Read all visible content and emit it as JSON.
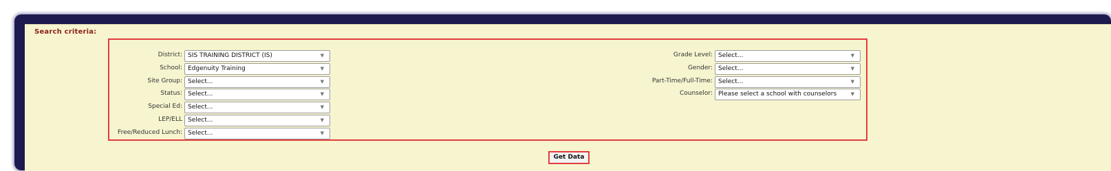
{
  "search": {
    "title": "Search criteria:",
    "left_fields": [
      {
        "label": "District:",
        "value": "SIS TRAINING DISTRICT (IS)"
      },
      {
        "label": "School:",
        "value": "Edgenuity Training"
      },
      {
        "label": "Site Group:",
        "value": "Select..."
      },
      {
        "label": "Status:",
        "value": "Select..."
      },
      {
        "label": "Special Ed:",
        "value": "Select..."
      },
      {
        "label": "LEP/ELL",
        "value": "Select..."
      },
      {
        "label": "Free/Reduced Lunch:",
        "value": "Select..."
      }
    ],
    "right_fields": [
      {
        "label": "Grade Level:",
        "value": "Select..."
      },
      {
        "label": "Gender:",
        "value": "Select..."
      },
      {
        "label": "Part-Time/Full-Time:",
        "value": "Select..."
      },
      {
        "label": "Counselor:",
        "value": "Please select a school with counselors"
      }
    ],
    "dropdown_arrow": "▼",
    "button_label": "Get Data"
  },
  "colors": {
    "frame": "#1c1a4e",
    "panel": "#f6f5d0",
    "title": "#8c1f14",
    "highlight": "#e33b3b"
  }
}
